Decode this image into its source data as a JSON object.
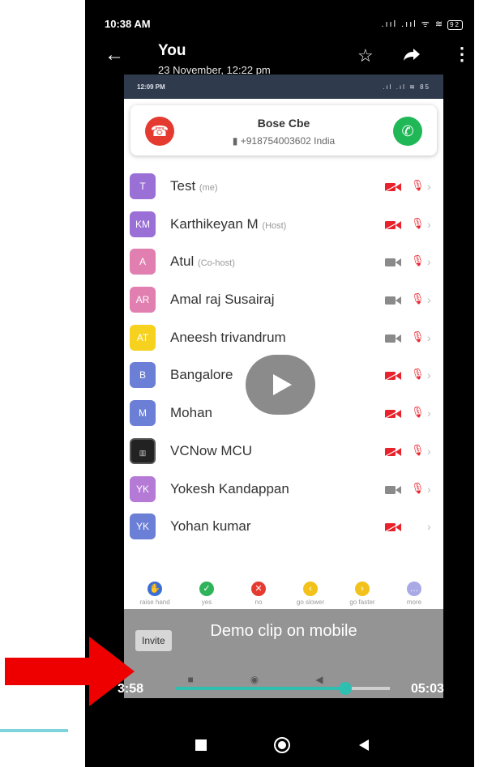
{
  "status_bar": {
    "time": "10:38 AM",
    "icons": ".ııl .ııl ᯤ ≋",
    "battery": "92"
  },
  "header": {
    "title": "You",
    "subtitle": "23 November, 12:22 pm"
  },
  "video": {
    "status_bar": {
      "time": "12:09 PM",
      "icons": ".ıl .ıl ≋",
      "battery": "85"
    },
    "caller": {
      "name": "Bose Cbe",
      "number": "+918754003602  India"
    },
    "participants": [
      {
        "initials": "T",
        "name": "Test",
        "role": "(me)",
        "color": "#9a6fd6",
        "cam": "off",
        "mic": "off"
      },
      {
        "initials": "KM",
        "name": "Karthikeyan M",
        "role": "(Host)",
        "color": "#9a6fd6",
        "cam": "off",
        "mic": "off"
      },
      {
        "initials": "A",
        "name": "Atul",
        "role": "(Co-host)",
        "color": "#e07fb0",
        "cam": "on",
        "mic": "off"
      },
      {
        "initials": "AR",
        "name": "Amal raj Susairaj",
        "role": "",
        "color": "#e07fb0",
        "cam": "on",
        "mic": "off"
      },
      {
        "initials": "AT",
        "name": "Aneesh trivandrum",
        "role": "",
        "color": "#f6d21f",
        "cam": "on",
        "mic": "off"
      },
      {
        "initials": "B",
        "name": "Bangalore",
        "role": "",
        "color": "#6b7fd6",
        "cam": "off",
        "mic": "off"
      },
      {
        "initials": "M",
        "name": "Mohan",
        "role": "",
        "color": "#6b7fd6",
        "cam": "off",
        "mic": "off"
      },
      {
        "initials": "",
        "name": "VCNow MCU",
        "role": "",
        "color": "#222222",
        "cam": "off",
        "mic": "off"
      },
      {
        "initials": "YK",
        "name": "Yokesh Kandappan",
        "role": "",
        "color": "#b47ad6",
        "cam": "on",
        "mic": "off"
      },
      {
        "initials": "YK",
        "name": "Yohan kumar",
        "role": "",
        "color": "#6b7fd6",
        "cam": "off",
        "mic": "none"
      }
    ],
    "reactions": [
      {
        "label": "raise hand",
        "color": "#3b6fd6",
        "glyph": "✋"
      },
      {
        "label": "yes",
        "color": "#2fb35a",
        "glyph": "✓"
      },
      {
        "label": "no",
        "color": "#e53a2f",
        "glyph": "✕"
      },
      {
        "label": "go slower",
        "color": "#f2c21a",
        "glyph": "‹"
      },
      {
        "label": "go faster",
        "color": "#f2c21a",
        "glyph": "›"
      },
      {
        "label": "more",
        "color": "#a9a9e6",
        "glyph": "…"
      }
    ],
    "invite_label": "Invite",
    "caption": "Demo clip on mobile"
  },
  "player": {
    "current_time": "3:58",
    "duration": "05:03",
    "progress": 0.79
  }
}
